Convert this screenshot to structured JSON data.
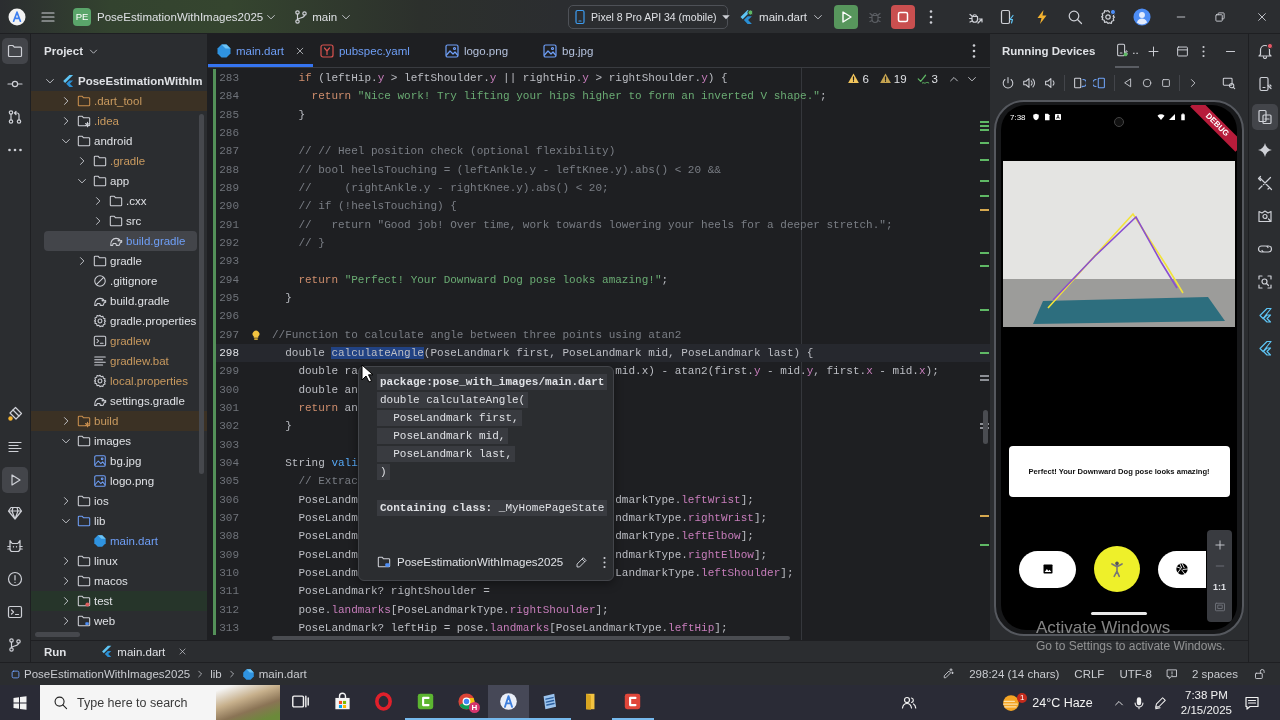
{
  "title_bar": {
    "project_badge": "PE",
    "project": "PoseEstimationWithImages2025",
    "branch": "main",
    "device": "Pixel 8 Pro API 34 (mobile)",
    "run_config": "main.dart",
    "run_config_running": true,
    "actions": [
      {
        "kind": "run",
        "disabled": false
      },
      {
        "kind": "debug",
        "disabled": true
      },
      {
        "kind": "stop",
        "disabled": false
      }
    ],
    "settings_badge": true
  },
  "left_stripe": {
    "top": [
      {
        "kind": "project",
        "selected": true
      },
      {
        "kind": "commit",
        "selected": false
      },
      {
        "kind": "pull-requests",
        "selected": false
      },
      {
        "kind": "more",
        "selected": false
      }
    ],
    "bottom": [
      {
        "kind": "inspector",
        "selected": false
      },
      {
        "kind": "structure",
        "selected": false
      },
      {
        "kind": "run",
        "selected": true
      },
      {
        "kind": "gem",
        "selected": false
      },
      {
        "kind": "logcat",
        "selected": false
      },
      {
        "kind": "problems",
        "selected": false
      },
      {
        "kind": "terminal",
        "selected": false
      },
      {
        "kind": "vcs",
        "selected": false
      }
    ]
  },
  "project_panel": {
    "title": "Project",
    "tree": [
      {
        "label": "PoseEstimationWithIm",
        "kind": "project",
        "ignored": false,
        "modified": false,
        "selected": false,
        "excluded": false,
        "expanded": true,
        "children": [
          {
            "label": ".dart_tool",
            "kind": "folder",
            "ignored": true,
            "modified": false,
            "selected": false,
            "excluded": true,
            "expanded": false
          },
          {
            "label": ".idea",
            "kind": "generated-folder",
            "ignored": true,
            "modified": false,
            "selected": false,
            "excluded": false,
            "expanded": false
          },
          {
            "label": "android",
            "kind": "folder",
            "ignored": false,
            "modified": false,
            "selected": false,
            "excluded": false,
            "expanded": true,
            "children": [
              {
                "label": ".gradle",
                "kind": "folder",
                "ignored": true,
                "modified": false,
                "selected": false,
                "excluded": false,
                "expanded": false
              },
              {
                "label": "app",
                "kind": "folder",
                "ignored": false,
                "modified": false,
                "selected": false,
                "excluded": false,
                "expanded": true,
                "children": [
                  {
                    "label": ".cxx",
                    "kind": "folder",
                    "ignored": false,
                    "modified": false,
                    "selected": false,
                    "excluded": false,
                    "expanded": false
                  },
                  {
                    "label": "src",
                    "kind": "folder",
                    "ignored": false,
                    "modified": false,
                    "selected": false,
                    "excluded": false,
                    "expanded": false
                  },
                  {
                    "label": "build.gradle",
                    "kind": "gradle-file",
                    "ignored": false,
                    "modified": true,
                    "selected": true,
                    "excluded": false
                  }
                ]
              },
              {
                "label": "gradle",
                "kind": "folder",
                "ignored": false,
                "modified": false,
                "selected": false,
                "excluded": false,
                "expanded": false
              },
              {
                "label": ".gitignore",
                "kind": "ignore-file",
                "ignored": false,
                "modified": false,
                "selected": false,
                "excluded": false
              },
              {
                "label": "build.gradle",
                "kind": "gradle-file",
                "ignored": false,
                "modified": false,
                "selected": false,
                "excluded": false
              },
              {
                "label": "gradle.properties",
                "kind": "properties-file",
                "ignored": false,
                "modified": false,
                "selected": false,
                "excluded": false
              },
              {
                "label": "gradlew",
                "kind": "script-file",
                "ignored": true,
                "modified": false,
                "selected": false,
                "excluded": false
              },
              {
                "label": "gradlew.bat",
                "kind": "text-file",
                "ignored": true,
                "modified": false,
                "selected": false,
                "excluded": false
              },
              {
                "label": "local.properties",
                "kind": "properties-file",
                "ignored": true,
                "modified": false,
                "selected": false,
                "excluded": false
              },
              {
                "label": "settings.gradle",
                "kind": "gradle-file",
                "ignored": false,
                "modified": false,
                "selected": false,
                "excluded": false
              }
            ]
          },
          {
            "label": "build",
            "kind": "generated-folder",
            "ignored": true,
            "modified": false,
            "selected": false,
            "excluded": true,
            "expanded": false
          },
          {
            "label": "images",
            "kind": "folder",
            "ignored": false,
            "modified": false,
            "selected": false,
            "excluded": false,
            "expanded": true,
            "children": [
              {
                "label": "bg.jpg",
                "kind": "image-file",
                "ignored": false,
                "modified": false,
                "selected": false,
                "excluded": false
              },
              {
                "label": "logo.png",
                "kind": "image-file",
                "ignored": false,
                "modified": false,
                "selected": false,
                "excluded": false
              }
            ]
          },
          {
            "label": "ios",
            "kind": "folder",
            "ignored": false,
            "modified": false,
            "selected": false,
            "excluded": false,
            "expanded": false
          },
          {
            "label": "lib",
            "kind": "source-folder",
            "ignored": false,
            "modified": false,
            "selected": false,
            "excluded": false,
            "expanded": true,
            "children": [
              {
                "label": "main.dart",
                "kind": "dart-file",
                "ignored": false,
                "modified": true,
                "selected": false,
                "excluded": false
              }
            ]
          },
          {
            "label": "linux",
            "kind": "folder",
            "ignored": false,
            "modified": false,
            "selected": false,
            "excluded": false,
            "expanded": false
          },
          {
            "label": "macos",
            "kind": "folder",
            "ignored": false,
            "modified": false,
            "selected": false,
            "excluded": false,
            "expanded": false
          },
          {
            "label": "test",
            "kind": "test-folder",
            "ignored": false,
            "modified": false,
            "selected": false,
            "excluded": false,
            "expanded": false
          },
          {
            "label": "web",
            "kind": "web-folder",
            "ignored": false,
            "modified": false,
            "selected": false,
            "excluded": false,
            "expanded": false
          }
        ]
      }
    ]
  },
  "editor": {
    "tabs": [
      {
        "label": "main.dart",
        "kind": "dart",
        "modified": true,
        "selected": true
      },
      {
        "label": "pubspec.yaml",
        "kind": "yaml",
        "modified": true,
        "selected": false
      },
      {
        "label": "logo.png",
        "kind": "image",
        "modified": false,
        "selected": false
      },
      {
        "label": "bg.jpg",
        "kind": "image",
        "modified": false,
        "selected": false
      }
    ],
    "inspections": [
      {
        "kind": "warning",
        "count": "6"
      },
      {
        "kind": "weak-warning",
        "count": "19"
      },
      {
        "kind": "typo",
        "count": "3"
      }
    ],
    "lines": [
      {
        "number": "283",
        "current": false,
        "tokens": [
          {
            "text": "    if",
            "kind": "keyword"
          },
          {
            "text": " (leftHip.",
            "kind": "plain"
          },
          {
            "text": "y",
            "kind": "field"
          },
          {
            "text": " > leftShoulder.",
            "kind": "plain"
          },
          {
            "text": "y",
            "kind": "field"
          },
          {
            "text": " || rightHip.",
            "kind": "plain"
          },
          {
            "text": "y",
            "kind": "field"
          },
          {
            "text": " > rightShoulder.",
            "kind": "plain"
          },
          {
            "text": "y",
            "kind": "field"
          },
          {
            "text": ") {",
            "kind": "plain"
          }
        ]
      },
      {
        "number": "284",
        "current": false,
        "tokens": [
          {
            "text": "      return ",
            "kind": "keyword"
          },
          {
            "text": "\"Nice work! Try lifting your hips higher to form an inverted V shape.\"",
            "kind": "string"
          },
          {
            "text": ";",
            "kind": "plain"
          }
        ]
      },
      {
        "number": "285",
        "current": false,
        "tokens": [
          {
            "text": "    }",
            "kind": "plain"
          }
        ]
      },
      {
        "number": "286",
        "current": false
      },
      {
        "number": "287",
        "current": false,
        "tokens": [
          {
            "text": "    // // Heel position check (optional flexibility)",
            "kind": "comment"
          }
        ]
      },
      {
        "number": "288",
        "current": false,
        "tokens": [
          {
            "text": "    // bool heelsTouching = (leftAnkle.y - leftKnee.y).abs() < 20 &&",
            "kind": "comment"
          }
        ]
      },
      {
        "number": "289",
        "current": false,
        "tokens": [
          {
            "text": "    //     (rightAnkle.y - rightKnee.y).abs() < 20;",
            "kind": "comment"
          }
        ]
      },
      {
        "number": "290",
        "current": false,
        "tokens": [
          {
            "text": "    // if (!heelsTouching) {",
            "kind": "comment"
          }
        ]
      },
      {
        "number": "291",
        "current": false,
        "tokens": [
          {
            "text": "    //   return \"Good job! Over time, work towards lowering your heels for a deeper stretch.\";",
            "kind": "comment"
          }
        ]
      },
      {
        "number": "292",
        "current": false,
        "tokens": [
          {
            "text": "    // }",
            "kind": "comment"
          }
        ]
      },
      {
        "number": "293",
        "current": false
      },
      {
        "number": "294",
        "current": false,
        "tokens": [
          {
            "text": "    return ",
            "kind": "keyword"
          },
          {
            "text": "\"Perfect! Your Downward Dog pose looks amazing!\"",
            "kind": "string"
          },
          {
            "text": ";",
            "kind": "plain"
          }
        ]
      },
      {
        "number": "295",
        "current": false,
        "tokens": [
          {
            "text": "  }",
            "kind": "plain"
          }
        ]
      },
      {
        "number": "296",
        "current": false
      },
      {
        "number": "297",
        "current": false,
        "tokens": [
          {
            "text": "//Function to calculate angle between three points using atan2",
            "kind": "comment"
          }
        ]
      },
      {
        "number": "298",
        "current": true,
        "tokens": [
          {
            "text": "  double ",
            "kind": "plain"
          },
          {
            "text": "calculateAngle",
            "kind": "selection"
          },
          {
            "text": "(PoseLandmark first, PoseLandmark mid, PoseLandmark last) {",
            "kind": "plain"
          }
        ]
      },
      {
        "number": "299",
        "current": false,
        "tokens": [
          {
            "text": "    double ra",
            "kind": "plain"
          }
        ],
        "tokens_right": [
          {
            "text": "mid.x) - atan2(first.",
            "kind": "plain"
          },
          {
            "text": "y",
            "kind": "field"
          },
          {
            "text": " - mid.",
            "kind": "plain"
          },
          {
            "text": "y",
            "kind": "field"
          },
          {
            "text": ", first.",
            "kind": "plain"
          },
          {
            "text": "x",
            "kind": "field"
          },
          {
            "text": " - mid.",
            "kind": "plain"
          },
          {
            "text": "x",
            "kind": "field"
          },
          {
            "text": ");",
            "kind": "plain"
          }
        ]
      },
      {
        "number": "300",
        "current": false,
        "tokens": [
          {
            "text": "    double an",
            "kind": "plain"
          }
        ]
      },
      {
        "number": "301",
        "current": false,
        "tokens": [
          {
            "text": "    return",
            "kind": "keyword"
          },
          {
            "text": " an",
            "kind": "plain"
          }
        ]
      },
      {
        "number": "302",
        "current": false,
        "tokens": [
          {
            "text": "  }",
            "kind": "plain"
          }
        ]
      },
      {
        "number": "303",
        "current": false
      },
      {
        "number": "304",
        "current": false,
        "tokens": [
          {
            "text": "  String ",
            "kind": "plain"
          },
          {
            "text": "vali",
            "kind": "function"
          }
        ]
      },
      {
        "number": "305",
        "current": false,
        "tokens": [
          {
            "text": "    // Extrac",
            "kind": "comment"
          }
        ]
      },
      {
        "number": "306",
        "current": false,
        "tokens": [
          {
            "text": "    PoseLandm",
            "kind": "plain"
          }
        ],
        "tokens_right": [
          {
            "text": "dmarkType.",
            "kind": "plain"
          },
          {
            "text": "leftWrist",
            "kind": "field"
          },
          {
            "text": "];",
            "kind": "plain"
          }
        ]
      },
      {
        "number": "307",
        "current": false,
        "tokens": [
          {
            "text": "    PoseLandm",
            "kind": "plain"
          }
        ],
        "tokens_right": [
          {
            "text": "ndmarkType.",
            "kind": "plain"
          },
          {
            "text": "rightWrist",
            "kind": "field"
          },
          {
            "text": "];",
            "kind": "plain"
          }
        ]
      },
      {
        "number": "308",
        "current": false,
        "tokens": [
          {
            "text": "    PoseLandm",
            "kind": "plain"
          }
        ],
        "tokens_right": [
          {
            "text": "dmarkType.",
            "kind": "plain"
          },
          {
            "text": "leftElbow",
            "kind": "field"
          },
          {
            "text": "];",
            "kind": "plain"
          }
        ]
      },
      {
        "number": "309",
        "current": false,
        "tokens": [
          {
            "text": "    PoseLandm",
            "kind": "plain"
          }
        ],
        "tokens_right": [
          {
            "text": "ndmarkType.",
            "kind": "plain"
          },
          {
            "text": "rightElbow",
            "kind": "field"
          },
          {
            "text": "];",
            "kind": "plain"
          }
        ]
      },
      {
        "number": "310",
        "current": false,
        "tokens": [
          {
            "text": "    PoseLandm",
            "kind": "plain"
          }
        ],
        "tokens_right": [
          {
            "text": "LandmarkType.",
            "kind": "plain"
          },
          {
            "text": "leftShoulder",
            "kind": "field"
          },
          {
            "text": "];",
            "kind": "plain"
          }
        ]
      },
      {
        "number": "311",
        "current": false,
        "tokens": [
          {
            "text": "    PoseLandmark? rightShoulder =",
            "kind": "plain"
          }
        ]
      },
      {
        "number": "312",
        "current": false,
        "tokens": [
          {
            "text": "    pose.",
            "kind": "plain"
          },
          {
            "text": "landmarks",
            "kind": "field"
          },
          {
            "text": "[PoseLandmarkType.",
            "kind": "plain"
          },
          {
            "text": "rightShoulder",
            "kind": "field"
          },
          {
            "text": "];",
            "kind": "plain"
          }
        ]
      },
      {
        "number": "313",
        "current": false,
        "tokens": [
          {
            "text": "    PoseLandmark? leftHip = pose.",
            "kind": "plain"
          },
          {
            "text": "landmarks",
            "kind": "field"
          },
          {
            "text": "[PoseLandmarkType.",
            "kind": "plain"
          },
          {
            "text": "leftHip",
            "kind": "field"
          },
          {
            "text": "];",
            "kind": "plain"
          }
        ]
      }
    ],
    "doc_popup": {
      "package": "package:pose_with_images/main.dart",
      "signature": [
        "double calculateAngle(",
        "  PoseLandmark first,",
        "  PoseLandmark mid,",
        "  PoseLandmark last,",
        ")"
      ],
      "containing_class": "**Containing class:** _MyHomePageState",
      "project": "PoseEstimationWithImages2025"
    }
  },
  "running_devices": {
    "title": "Running Devices",
    "device_tab": "..",
    "phone": {
      "time": "7:38",
      "debug_banner": "DEBUG",
      "result": "Perfect! Your Downward Dog pose looks amazing!",
      "zoom_actual_size": "1:1"
    }
  },
  "right_stripe": {
    "notifications_unread": true,
    "items": [
      {
        "kind": "device",
        "selected": false
      },
      {
        "kind": "running-devices",
        "selected": true
      },
      {
        "kind": "sparkle",
        "selected": false
      },
      {
        "kind": "tools",
        "selected": false
      },
      {
        "kind": "gallery",
        "selected": false
      },
      {
        "kind": "link",
        "selected": false
      },
      {
        "kind": "scan",
        "selected": false
      },
      {
        "kind": "flutter",
        "selected": false
      },
      {
        "kind": "flutter",
        "selected": false
      }
    ]
  },
  "run_bar": {
    "title": "Run",
    "tabs": [
      {
        "label": "main.dart",
        "selected": true
      }
    ]
  },
  "status_bar": {
    "breadcrumbs": [
      {
        "kind": "project",
        "label": "PoseEstimationWithImages2025"
      },
      {
        "kind": "folder",
        "label": "lib"
      },
      {
        "kind": "dart",
        "label": "main.dart"
      }
    ],
    "position": "298:24 (14 chars)",
    "line_separator": "CRLF",
    "encoding": "UTF-8",
    "indent": "2 spaces"
  },
  "os_notice": {
    "title": "Activate Windows",
    "hint": "Go to Settings to activate Windows."
  },
  "taskbar": {
    "search_placeholder": "Type here to search",
    "apps": [
      {
        "kind": "task-view",
        "selected": false,
        "running": false
      },
      {
        "kind": "store",
        "selected": false,
        "running": false
      },
      {
        "kind": "ring",
        "selected": false,
        "running": false
      },
      {
        "kind": "bracket",
        "selected": false,
        "running": true
      },
      {
        "kind": "wheel",
        "selected": false,
        "running": true,
        "badge": "H"
      },
      {
        "kind": "compass",
        "selected": true,
        "running": true
      },
      {
        "kind": "document",
        "selected": false,
        "running": true
      },
      {
        "kind": "folder",
        "selected": false,
        "running": false
      },
      {
        "kind": "box",
        "selected": false,
        "running": true
      }
    ],
    "weather_alerts": "1",
    "weather": "24°C Haze",
    "time": "7:38 PM",
    "date": "2/15/2025"
  }
}
